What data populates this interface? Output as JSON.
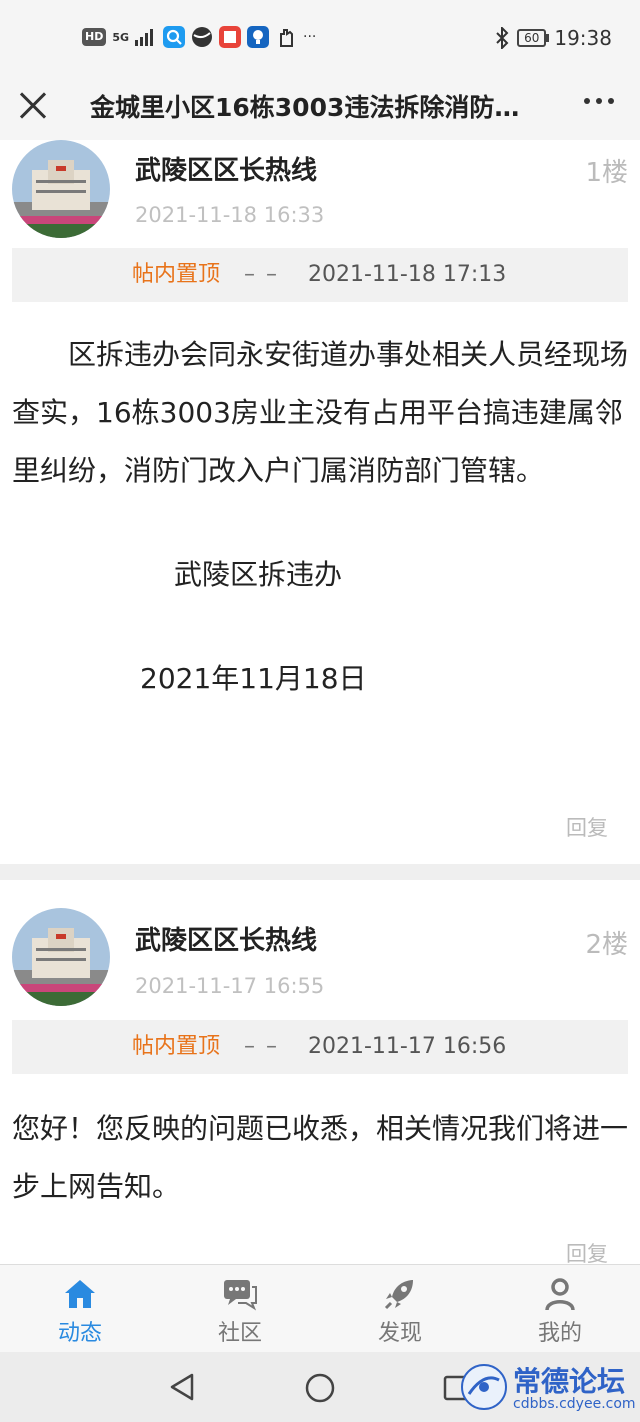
{
  "status_bar": {
    "left_items": [
      "HD",
      "5G",
      "46"
    ],
    "battery": "60",
    "time": "19:38",
    "more": "···"
  },
  "header": {
    "title": "金城里小区16栋3003违法拆除消防…"
  },
  "posts": [
    {
      "author": "武陵区区长热线",
      "floor": "1楼",
      "time": "2021-11-18 16:33",
      "pin_label": "帖内置顶",
      "pin_dash": "– –",
      "pin_time": "2021-11-18 17:13",
      "body": [
        "　　区拆违办会同永安街道办事处相关人员经现场查实，16栋3003房业主没有占用平台搞违建属邻里纠纷，消防门改入户门属消防部门管辖。",
        "",
        "　　　　武陵区拆违办",
        "",
        "　　　2021年11月18日"
      ],
      "reply": "回复"
    },
    {
      "author": "武陵区区长热线",
      "floor": "2楼",
      "time": "2021-11-17 16:55",
      "pin_label": "帖内置顶",
      "pin_dash": "– –",
      "pin_time": "2021-11-17 16:56",
      "body": [
        "您好！您反映的问题已收悉，相关情况我们将进一步上网告知。"
      ],
      "reply": "回复"
    }
  ],
  "bottom_nav": [
    {
      "label": "动态",
      "icon": "home-icon",
      "active": true
    },
    {
      "label": "社区",
      "icon": "chat-icon",
      "active": false
    },
    {
      "label": "发现",
      "icon": "rocket-icon",
      "active": false
    },
    {
      "label": "我的",
      "icon": "user-icon",
      "active": false
    }
  ],
  "watermark": {
    "text": "常德论坛",
    "sub": "cdbbs.cdyee.com"
  },
  "colors": {
    "accent": "#2a8ae0",
    "pin": "#e8731a"
  }
}
